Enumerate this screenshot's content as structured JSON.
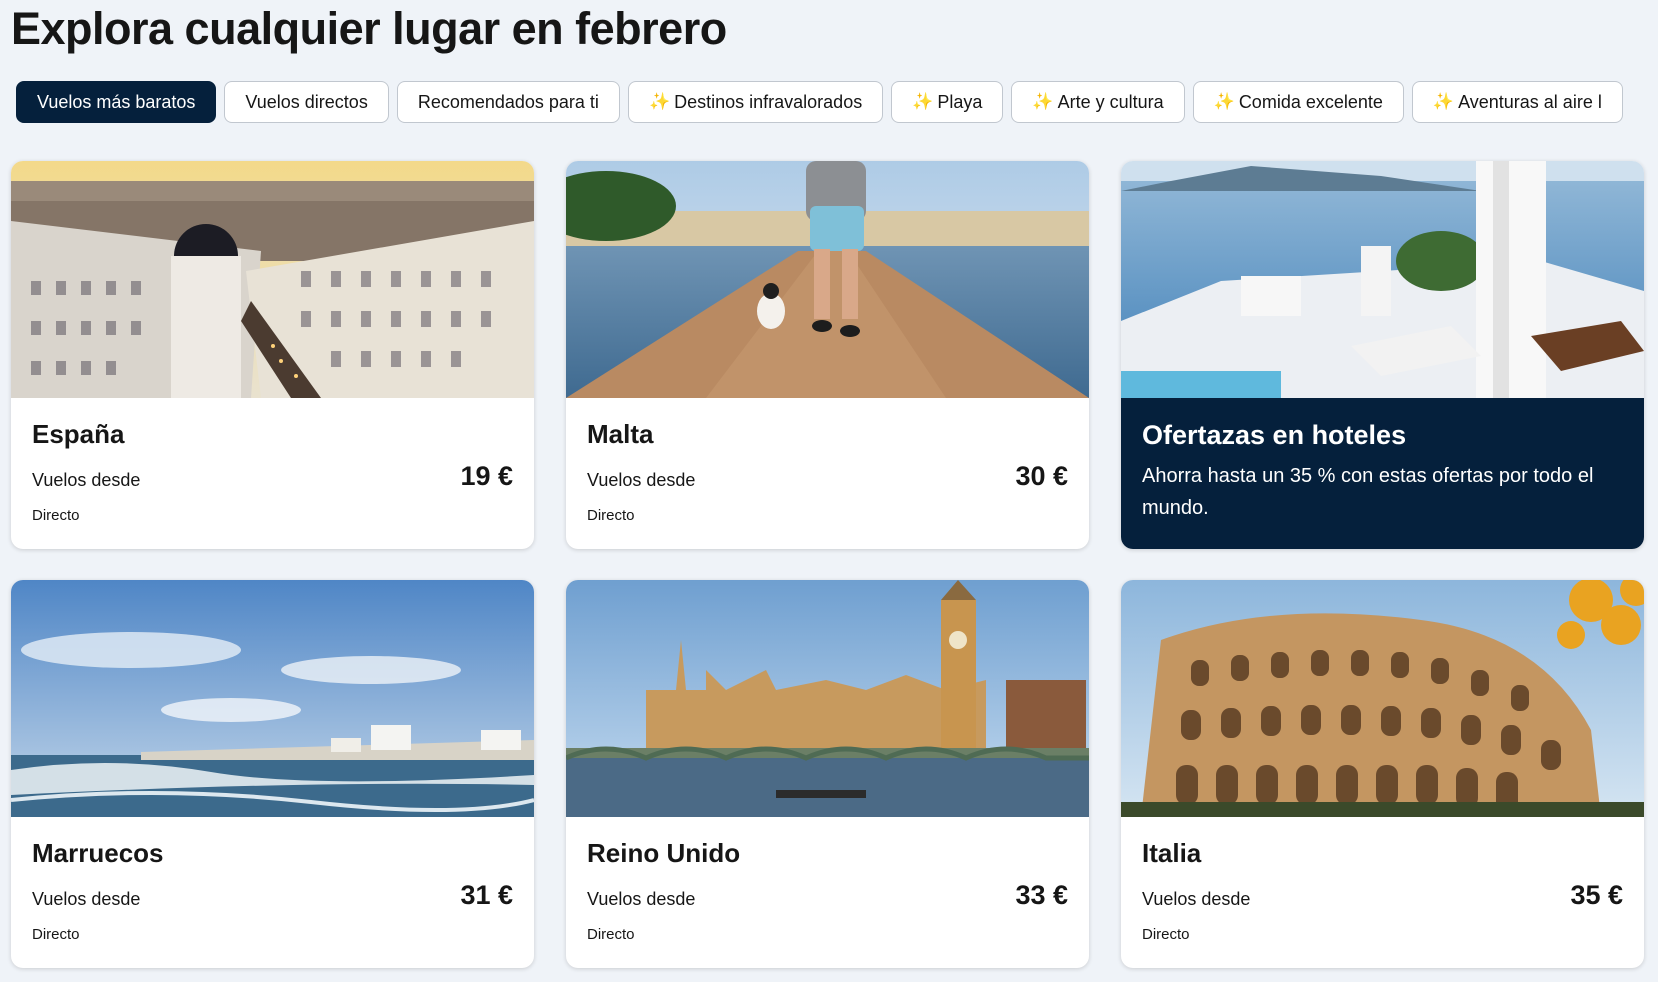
{
  "page": {
    "title": "Explora cualquier lugar en febrero"
  },
  "filters": [
    {
      "label": "Vuelos más baratos",
      "active": true,
      "sparkle": false
    },
    {
      "label": "Vuelos directos",
      "active": false,
      "sparkle": false
    },
    {
      "label": "Recomendados para ti",
      "active": false,
      "sparkle": false
    },
    {
      "label": "Destinos infravalorados",
      "active": false,
      "sparkle": true
    },
    {
      "label": "Playa",
      "active": false,
      "sparkle": true
    },
    {
      "label": "Arte y cultura",
      "active": false,
      "sparkle": true
    },
    {
      "label": "Comida excelente",
      "active": false,
      "sparkle": true
    },
    {
      "label": "Aventuras al aire l",
      "active": false,
      "sparkle": true
    }
  ],
  "sparkle_icon": "sparkles-icon",
  "destinations": [
    {
      "name": "España",
      "from_label": "Vuelos desde",
      "price": "19 €",
      "route": "Directo",
      "image": "madrid-city-photo"
    },
    {
      "name": "Malta",
      "from_label": "Vuelos desde",
      "price": "30 €",
      "route": "Directo",
      "image": "malta-pier-photo"
    },
    {
      "name": "Marruecos",
      "from_label": "Vuelos desde",
      "price": "31 €",
      "route": "Directo",
      "image": "morocco-coast-photo"
    },
    {
      "name": "Reino Unido",
      "from_label": "Vuelos desde",
      "price": "33 €",
      "route": "Directo",
      "image": "london-parliament-photo"
    },
    {
      "name": "Italia",
      "from_label": "Vuelos desde",
      "price": "35 €",
      "route": "Directo",
      "image": "rome-colosseum-photo"
    }
  ],
  "promo": {
    "title": "Ofertazas en hoteles",
    "text": "Ahorra hasta un 35 % con estas ofertas por todo el mundo.",
    "image": "hotel-terrace-sea-photo"
  },
  "colors": {
    "background": "#eff3f8",
    "brand_dark": "#05203c",
    "text": "#161616",
    "card": "#ffffff",
    "sparkle": "#f4c542"
  }
}
